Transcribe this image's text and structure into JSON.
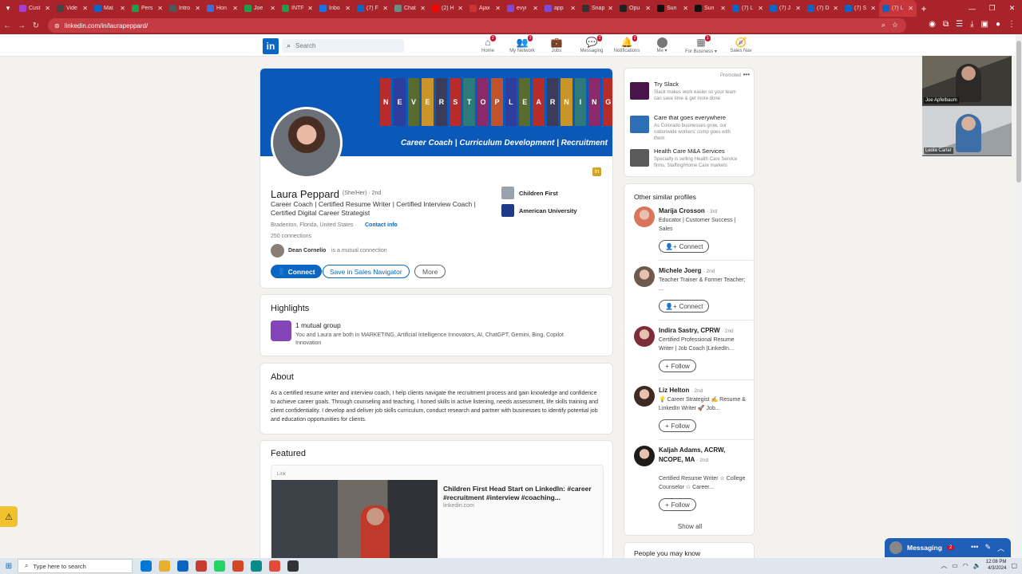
{
  "browser": {
    "tabs": [
      {
        "label": "Cust",
        "color": "#a63fd0"
      },
      {
        "label": "Vide",
        "color": "#444444"
      },
      {
        "label": "Mat",
        "color": "#0a66c2"
      },
      {
        "label": "Pers",
        "color": "#1e9e4a"
      },
      {
        "label": "Intro",
        "color": "#555555"
      },
      {
        "label": "Hon",
        "color": "#3f6fd8"
      },
      {
        "label": "Joe",
        "color": "#1e9e4a"
      },
      {
        "label": "INTF",
        "color": "#1e9e4a"
      },
      {
        "label": "Inbo",
        "color": "#1a73e8"
      },
      {
        "label": "(7) F",
        "color": "#0a66c2"
      },
      {
        "label": "Chat",
        "color": "#6b8e83"
      },
      {
        "label": "(2) H",
        "color": "#ff0000"
      },
      {
        "label": "Ajax",
        "color": "#cc3333"
      },
      {
        "label": "evyi",
        "color": "#7d4ad8"
      },
      {
        "label": "app",
        "color": "#7d4ad8"
      },
      {
        "label": "Snap",
        "color": "#333333"
      },
      {
        "label": "Opu",
        "color": "#222222"
      },
      {
        "label": "Sun",
        "color": "#111111"
      },
      {
        "label": "Sun",
        "color": "#111111"
      },
      {
        "label": "(7) L",
        "color": "#0a66c2"
      },
      {
        "label": "(7) J",
        "color": "#0a66c2"
      },
      {
        "label": "(7) D",
        "color": "#0a66c2"
      },
      {
        "label": "(7) S",
        "color": "#0a66c2"
      },
      {
        "label": "(7) L",
        "color": "#0a66c2",
        "active": true
      }
    ],
    "url": "linkedin.com/in/laurapeppard/"
  },
  "linkedin": {
    "logo": "in",
    "search_placeholder": "Search",
    "nav": [
      {
        "label": "Home",
        "icon": "home-icon",
        "glyph": "⌂",
        "badge": "2"
      },
      {
        "label": "My Network",
        "icon": "network-icon",
        "glyph": "👥",
        "badge": "3"
      },
      {
        "label": "Jobs",
        "icon": "briefcase-icon",
        "glyph": "💼",
        "badge": ""
      },
      {
        "label": "Messaging",
        "icon": "chat-icon",
        "glyph": "💬",
        "badge": "2"
      },
      {
        "label": "Notifications",
        "icon": "bell-icon",
        "glyph": "🔔",
        "badge": "2"
      },
      {
        "label": "Me ▾",
        "icon": "avatar-icon",
        "glyph": "",
        "badge": ""
      },
      {
        "label": "For Business ▾",
        "icon": "grid-icon",
        "glyph": "▦",
        "badge": "1"
      },
      {
        "label": "Sales Nav",
        "icon": "compass-icon",
        "glyph": "🧭",
        "badge": ""
      }
    ]
  },
  "profile": {
    "banner_letters": [
      "N",
      "E",
      "V",
      "E",
      "R",
      "S",
      "T",
      "O",
      "P",
      "L",
      "E",
      "A",
      "R",
      "N",
      "I",
      "N",
      "G"
    ],
    "banner_tagline": "Career Coach |  Curriculum Development | Recruitment",
    "name": "Laura Peppard",
    "pronouns": "(She/Her) · 2nd",
    "headline": "Career Coach | Certified Resume Writer | Certified Interview Coach | Certified Digital Career Strategist",
    "location": "Bradenton, Florida, United States ·",
    "contact_info": "Contact info",
    "connections": "250 connections",
    "mutual_name": "Dean Cornelio",
    "mutual_rest": "is a mutual connection",
    "connect_label": "Connect",
    "save_label": "Save in Sales Navigator",
    "more_label": "More",
    "experience": [
      {
        "label": "Children First",
        "color": "#9aa3ad"
      },
      {
        "label": "American University",
        "color": "#1f3a8a"
      }
    ]
  },
  "highlights": {
    "title": "Highlights",
    "group_title": "1 mutual group",
    "group_desc": "You and Laura are both in MARKETING, Artificial Intelligence Innovators, AI, ChatGPT, Gemini, Bing, Copilot Innovation"
  },
  "about": {
    "title": "About",
    "text": "As a certified resume writer and interview coach, I help clients navigate the recruitment process and gain knowledge and confidence to achieve career goals. Through counseling and teaching, I honed skills in active listening, needs assessment, life skills training and client confidentiality. I develop and deliver job skills curriculum, conduct research and partner with businesses to identify potential job and education opportunities for clients."
  },
  "featured": {
    "title": "Featured",
    "kind": "Link",
    "item_title": "Children First Head Start on LinkedIn: #career #recruitment #interview #coaching...",
    "item_source": "linkedin.com"
  },
  "promoted": {
    "label": "Promoted",
    "items": [
      {
        "title": "Try Slack",
        "desc": "Slack makes work easier so your team can save time & get more done",
        "color": "#4a154b"
      },
      {
        "title": "Care that goes everywhere",
        "desc": "As Colorado businesses grow, our nationwide workers' comp goes with them.",
        "color": "#2c6fb7"
      },
      {
        "title": "Health Care M&A Services",
        "desc": "Specialty is selling Health Care Service firms, Staffing/Home Care markets",
        "color": "#5a5a5a"
      }
    ]
  },
  "similar": {
    "title": "Other similar profiles",
    "items": [
      {
        "name": "Marija Crosson",
        "degree": "· 3rd",
        "desc": "Educator | Customer Success | Sales",
        "button": "Connect",
        "btn_icon": "👤+",
        "color": "#d9745f"
      },
      {
        "name": "Michele Joerg",
        "degree": "· 2nd",
        "desc": "Teacher Trainer & Former Teacher; ...",
        "button": "Connect",
        "btn_icon": "👤+",
        "color": "#6d5a4c"
      },
      {
        "name": "Indira Sastry, CPRW",
        "degree": "· 2nd",
        "desc": "Certified Professional Resume Writer | Job Coach |LinkedIn...",
        "button": "Follow",
        "btn_icon": "+",
        "color": "#7b2d3a"
      },
      {
        "name": "Liz Helton",
        "degree": "· 2nd",
        "desc": "💡 Career Strategist ✍️ Resume & LinkedIn Writer 🚀 Job...",
        "button": "Follow",
        "btn_icon": "+",
        "color": "#3d2b24"
      },
      {
        "name": "Kaljah Adams, ACRW, NCOPE, MA",
        "degree": "· 2nd",
        "desc": "Certified Resume Writer ☆ College Counselor ☆ Career...",
        "button": "Follow",
        "btn_icon": "+",
        "color": "#1f1b1a"
      }
    ],
    "show_all": "Show all"
  },
  "people_you_may_know": "People you may know",
  "video": {
    "participant1": "Joe Apfelbaum",
    "participant2": "Leola Carter"
  },
  "messaging": {
    "label": "Messaging",
    "badge": "2"
  },
  "taskbar": {
    "search_placeholder": "Type here to search",
    "time": "12:08 PM",
    "date": "4/3/2024",
    "apps": [
      "#0078d4",
      "#e8b02d",
      "#0a66c2",
      "#c63c2f",
      "#25d366",
      "#d24726",
      "#0b8a8a",
      "#e24b3a",
      "#333333"
    ]
  }
}
